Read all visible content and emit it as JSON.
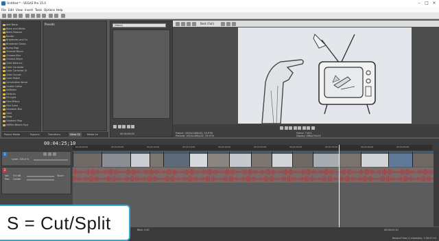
{
  "window": {
    "title": "Untitled * - VEGAS Pro 15.0"
  },
  "menu": [
    "File",
    "Edit",
    "View",
    "Insert",
    "Tools",
    "Options",
    "Help"
  ],
  "explorer": {
    "items": [
      "Add Noise",
      "Black and White",
      "Black Restore",
      "Border",
      "Brightness and Co",
      "Broadcast Colors",
      "Bump Map",
      "Channel Blend",
      "Chroma Blur",
      "Chroma Keyer",
      "Color Balance",
      "Color Corrector",
      "Color Corrector (S",
      "Color Curves",
      "Color Match",
      "Convolution Kerne",
      "Cookie Cutter",
      "Deflicker",
      "Defocus",
      "Fill Light",
      "Film Effects",
      "Film Grain",
      "Gaussian Blur",
      "Glint",
      "Glow",
      "Gradient Map",
      "HitFilm Bleach Byp"
    ]
  },
  "presets": {
    "header": "Presets"
  },
  "bottom_tabs": [
    "Project Media",
    "Explorer",
    "Transitions",
    "Video FX",
    "Media Ge"
  ],
  "trimmer": {
    "field": "(None)",
    "time": "00:00:00;00"
  },
  "preview": {
    "quality": "Best (Full)",
    "project_line": "Project:   1920x1080x32, 29.970i",
    "preview_line": "Preview:   1920x1080x32, 29.970i",
    "frame_line": "Frame:   7,622",
    "display_line": "Display:   488x274x32"
  },
  "timeline": {
    "timecode": "00:04:25;10",
    "ruler_labels": [
      "00:04:00;00",
      "00:04:05;00",
      "00:04:10;00",
      "00:04:15;00",
      "00:04:20;00",
      "00:04:25;00",
      "00:04:30;00",
      "00:04:35;00",
      "00:04:40;00",
      "00:04:45;00"
    ],
    "video_track": {
      "number": "1",
      "level_label": "Level: 100.0 %"
    },
    "audio_track": {
      "number": "2",
      "vol_label": "Vol:",
      "vol_value": "0.0 dB",
      "pan_label": "Pan:",
      "pan_value": "Center",
      "touch_label": "Touch"
    }
  },
  "status": {
    "text": "Record Time (2 channels): 1:30:57:15",
    "rate": "Rate: 0.00",
    "end_time": "00:04:25;10"
  },
  "caption": {
    "text": "S = Cut/Split"
  },
  "colors": {
    "caption_border": "#3aa6d0",
    "folder": "#d8b94a",
    "audio_wave": "#b23a3a",
    "video_track": "#4a6f8a"
  }
}
